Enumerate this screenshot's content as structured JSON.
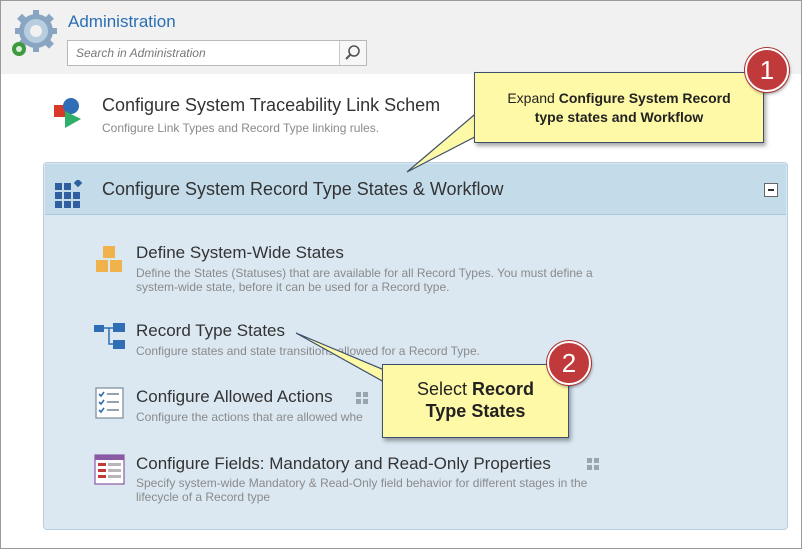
{
  "header": {
    "title": "Administration",
    "search_placeholder": "Search in Administration"
  },
  "traceability": {
    "title": "Configure System Traceability Link Schem",
    "description": "Configure Link Types and Record Type linking rules."
  },
  "states_workflow": {
    "title": "Configure System Record Type States & Workflow",
    "items": [
      {
        "title": "Define System-Wide States",
        "desc_line1": "Define the States (Statuses) that are available for all Record Types. You must define a",
        "desc_line2": "system-wide state, before it can be used for a Record type."
      },
      {
        "title": "Record Type States",
        "desc_line1": "Configure states and state transitions allowed for a Record Type."
      },
      {
        "title": "Configure Allowed Actions",
        "desc_line1": "Configure the actions that are allowed whe"
      },
      {
        "title": "Configure Fields: Mandatory and Read-Only Properties",
        "desc_line1": "Specify system-wide Mandatory & Read-Only field behavior for different stages in the",
        "desc_line2": "lifecycle of a Record type"
      }
    ]
  },
  "callout1": {
    "number": "1",
    "line1_plain": "Expand ",
    "line1_bold": "Configure System Record",
    "line2_bold": "type states and Workflow"
  },
  "callout2": {
    "number": "2",
    "line1_plain": "Select ",
    "line1_bold": "Record",
    "line2_bold": "Type States"
  },
  "colors": {
    "link_blue": "#2a6fb5",
    "panel_bg": "#dbe8f1",
    "callout_bg": "#fef9a6",
    "badge_red": "#c0393b"
  }
}
